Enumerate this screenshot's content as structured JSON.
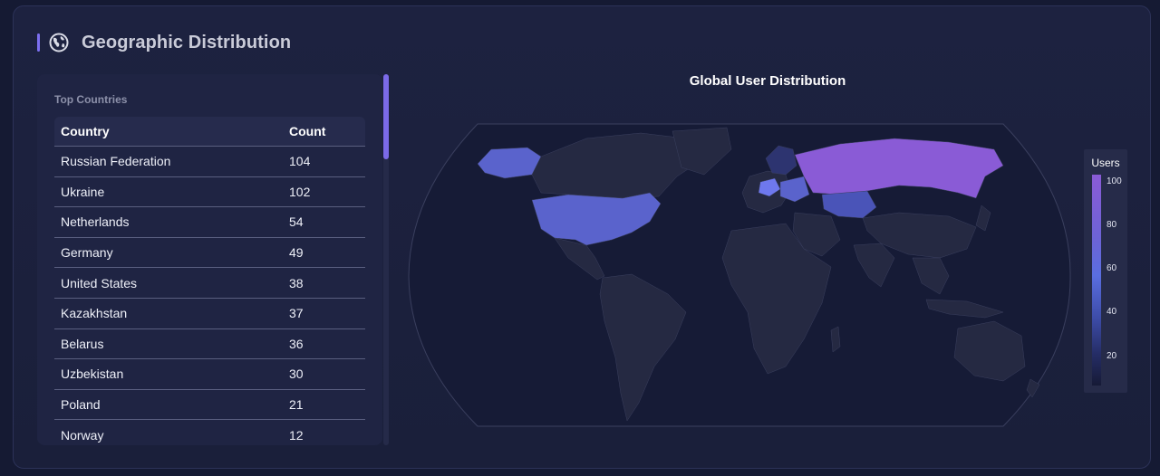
{
  "section": {
    "title": "Geographic Distribution",
    "icon": "globe-icon"
  },
  "table_panel": {
    "label": "Top Countries",
    "columns": [
      "Country",
      "Count"
    ],
    "rows": [
      {
        "country": "Russian Federation",
        "count": "104"
      },
      {
        "country": "Ukraine",
        "count": "102"
      },
      {
        "country": "Netherlands",
        "count": "54"
      },
      {
        "country": "Germany",
        "count": "49"
      },
      {
        "country": "United States",
        "count": "38"
      },
      {
        "country": "Kazakhstan",
        "count": "37"
      },
      {
        "country": "Belarus",
        "count": "36"
      },
      {
        "country": "Uzbekistan",
        "count": "30"
      },
      {
        "country": "Poland",
        "count": "21"
      },
      {
        "country": "Norway",
        "count": "12"
      }
    ]
  },
  "map": {
    "title": "Global User Distribution",
    "legend": {
      "title": "Users",
      "ticks": [
        "100",
        "80",
        "60",
        "40",
        "20"
      ]
    },
    "colors": {
      "high": "#8a5bd6",
      "mid": "#5a6ee0",
      "low": "#3d4ca8",
      "land": "#252942",
      "ocean": "#161b36"
    }
  }
}
